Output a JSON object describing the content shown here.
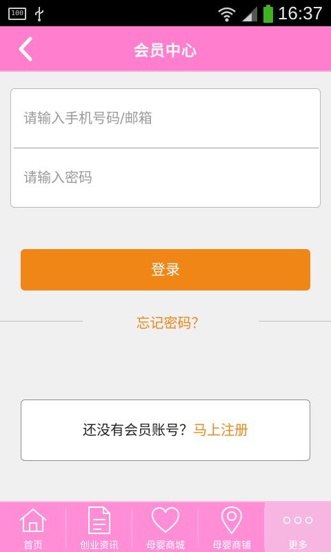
{
  "status_bar": {
    "battery_small_label": "100",
    "clock": "16:37",
    "icons": [
      "battery-percent-icon",
      "usb-icon",
      "wifi-icon",
      "signal-icon",
      "battery-icon"
    ]
  },
  "header": {
    "title": "会员中心",
    "back_icon": "chevron-left-icon"
  },
  "form": {
    "phone_placeholder": "请输入手机号码/邮箱",
    "password_placeholder": "请输入密码",
    "login_label": "登录",
    "forgot_label": "忘记密码？"
  },
  "register": {
    "prompt": "还没有会员账号？",
    "link": "马上注册"
  },
  "bottom_nav": {
    "items": [
      {
        "label": "首页",
        "icon": "home-icon"
      },
      {
        "label": "创业资讯",
        "icon": "document-icon"
      },
      {
        "label": "母婴商城",
        "icon": "heart-icon"
      },
      {
        "label": "母婴商铺",
        "icon": "location-pin-icon"
      },
      {
        "label": "更多",
        "icon": "more-dots-icon"
      }
    ],
    "active_index": 4
  },
  "colors": {
    "header": "#ff7fce",
    "accent_orange": "#f08615",
    "bottom_nav": "#ff8ed7"
  }
}
